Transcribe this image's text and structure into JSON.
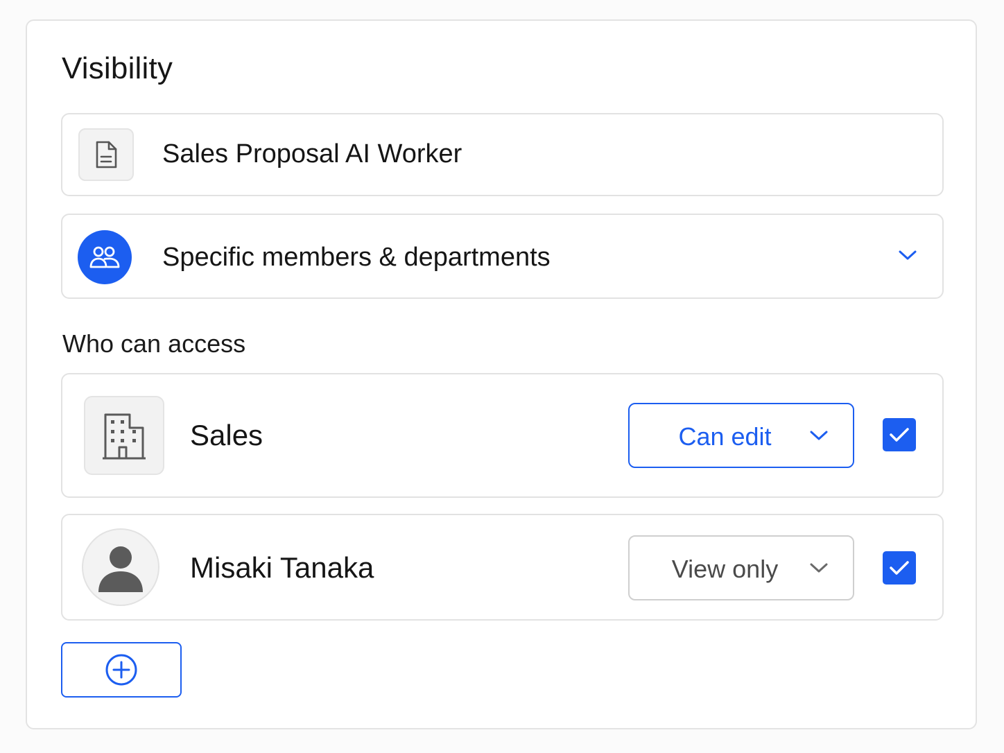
{
  "visibility": {
    "title": "Visibility",
    "document": {
      "name": "Sales Proposal AI Worker",
      "icon": "document-icon"
    },
    "scope": {
      "label": "Specific members & departments",
      "icon": "users-icon",
      "dropdown_icon": "chevron-down-icon"
    }
  },
  "access": {
    "label": "Who can access",
    "entries": [
      {
        "type": "department",
        "name": "Sales",
        "icon": "building-icon",
        "permission": "Can edit",
        "checked": true
      },
      {
        "type": "member",
        "name": "Misaki Tanaka",
        "icon": "user-avatar-icon",
        "permission": "View only",
        "checked": true
      }
    ],
    "add_icon": "plus-circle-icon"
  },
  "colors": {
    "accent": "#1c5ef0",
    "border": "#e2e2e2",
    "text": "#151515",
    "muted_text": "#4a4a4a"
  }
}
